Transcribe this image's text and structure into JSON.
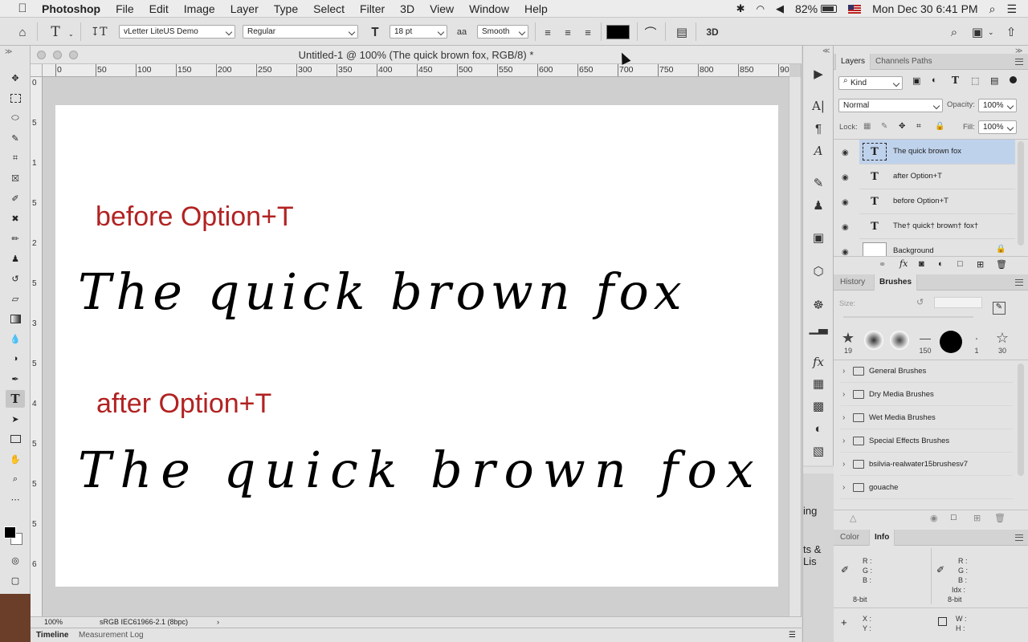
{
  "menubar": {
    "apple": "",
    "items": [
      "Photoshop",
      "File",
      "Edit",
      "Image",
      "Layer",
      "Type",
      "Select",
      "Filter",
      "3D",
      "View",
      "Window",
      "Help"
    ],
    "battery": "82%",
    "datetime": "Mon Dec 30  6:41 PM"
  },
  "options": {
    "font_family": "vLetter LiteUS Demo",
    "font_style": "Regular",
    "font_size": "18 pt",
    "antialias": "Smooth",
    "aa_icon": "aa",
    "threed": "3D",
    "color_swatch": "#000000"
  },
  "document": {
    "title": "Untitled-1 @ 100% (The quick brown fox, RGB/8) *",
    "ruler_marks": [
      "0",
      "50",
      "100",
      "150",
      "200",
      "250",
      "300",
      "350",
      "400",
      "450",
      "500",
      "550",
      "600",
      "650",
      "700",
      "750",
      "800",
      "850",
      "90"
    ],
    "vruler_marks": [
      "0",
      "5",
      "1",
      "5",
      "2",
      "5",
      "3",
      "5",
      "4",
      "5",
      "5",
      "5",
      "6"
    ],
    "label_before": "before Option+T",
    "label_after": "after Option+T",
    "script_text_1": "The quick brown fox",
    "script_text_2": "The quick brown fox",
    "label_color": "#b22222",
    "zoom": "100%",
    "color_profile": "sRGB IEC61966-2.1 (8bpc)"
  },
  "timeline": {
    "tab1": "Timeline",
    "tab2": "Measurement Log"
  },
  "hidden_panel": {
    "text1": "ing",
    "text2": "ts & Lis"
  },
  "layers": {
    "tabs": [
      "Layers",
      "Channels",
      "Paths"
    ],
    "filter": "Kind",
    "blend": "Normal",
    "opacity_label": "Opacity:",
    "opacity": "100%",
    "lock_label": "Lock:",
    "fill_label": "Fill:",
    "fill": "100%",
    "items": [
      {
        "name": "The quick brown fox",
        "kind": "T"
      },
      {
        "name": "after Option+T",
        "kind": "T"
      },
      {
        "name": "before Option+T",
        "kind": "T"
      },
      {
        "name": "The† quick† brown† fox†",
        "kind": "T"
      },
      {
        "name": "Background",
        "kind": ""
      }
    ]
  },
  "brushes": {
    "tabs": [
      "History",
      "Brushes"
    ],
    "size_label": "Size:",
    "presets": [
      "19",
      "",
      "",
      "150",
      "",
      "1",
      "30"
    ],
    "folders": [
      "General Brushes",
      "Dry Media Brushes",
      "Wet Media Brushes",
      "Special Effects Brushes",
      "bsilvia-realwater15brushesv7",
      "gouache"
    ]
  },
  "info": {
    "tabs": [
      "Color",
      "Info"
    ],
    "rgb_labels": [
      "R :",
      "G :",
      "B :"
    ],
    "bitdepth": "8-bit",
    "idx_label": "Idx :",
    "xy_labels": [
      "X :",
      "Y :"
    ],
    "wh_labels": [
      "W :",
      "H :"
    ]
  }
}
